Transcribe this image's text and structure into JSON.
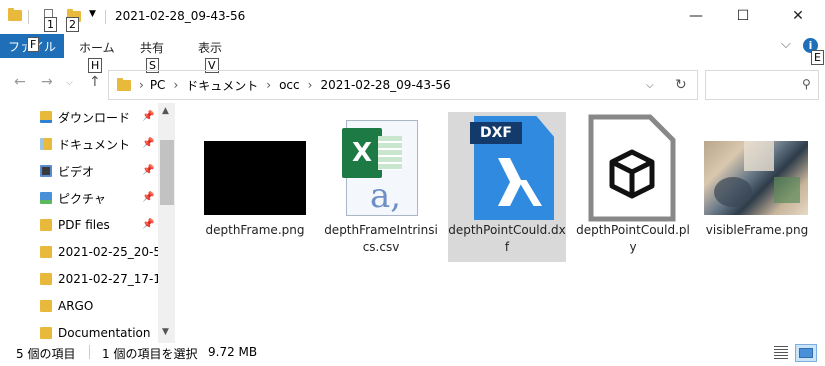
{
  "window": {
    "title": "2021-02-28_09-43-56",
    "minimize": "—",
    "maximize": "☐",
    "close": "✕"
  },
  "quick_access": {
    "key_tip_1": "1",
    "key_tip_2": "2"
  },
  "ribbon": {
    "file_tab": "ファイル",
    "file_key_tip": "F",
    "tabs": [
      {
        "label": "ホーム",
        "key_tip": "H"
      },
      {
        "label": "共有",
        "key_tip": "S"
      },
      {
        "label": "表示",
        "key_tip": "V"
      }
    ],
    "help_key_tip": "E"
  },
  "address": {
    "path": [
      "PC",
      "ドキュメント",
      "occ",
      "2021-02-28_09-43-56"
    ],
    "separator": "›"
  },
  "search": {
    "placeholder": ""
  },
  "nav_pane": {
    "items": [
      {
        "label": "ダウンロード",
        "pinned": true,
        "icon": "download-folder-icon"
      },
      {
        "label": "ドキュメント",
        "pinned": true,
        "icon": "documents-folder-icon"
      },
      {
        "label": "ビデオ",
        "pinned": true,
        "icon": "videos-folder-icon"
      },
      {
        "label": "ピクチャ",
        "pinned": true,
        "icon": "pictures-folder-icon"
      },
      {
        "label": "PDF files",
        "pinned": true,
        "icon": "folder-icon"
      },
      {
        "label": "2021-02-25_20-5",
        "pinned": false,
        "icon": "folder-icon"
      },
      {
        "label": "2021-02-27_17-1",
        "pinned": false,
        "icon": "folder-icon"
      },
      {
        "label": "ARGO",
        "pinned": false,
        "icon": "folder-icon"
      },
      {
        "label": "Documentation",
        "pinned": false,
        "icon": "folder-icon"
      }
    ]
  },
  "files": [
    {
      "name": "depthFrame.png",
      "icon": "png-thumbnail-icon",
      "selected": false
    },
    {
      "name": "depthFrameIntrinsics.csv",
      "icon": "excel-csv-icon",
      "selected": false
    },
    {
      "name": "depthPointCould.dxf",
      "icon": "dxf-file-icon",
      "selected": true,
      "badge": "DXF"
    },
    {
      "name": "depthPointCould.ply",
      "icon": "3d-object-icon",
      "selected": false
    },
    {
      "name": "visibleFrame.png",
      "icon": "image-thumbnail-icon",
      "selected": false
    }
  ],
  "status": {
    "item_count": "5 個の項目",
    "selection": "1 個の項目を選択",
    "size": "9.72 MB"
  },
  "colors": {
    "accent": "#1e6fb8",
    "folder": "#e8b93a",
    "selected_bg": "#d9d9d9",
    "dxf_blue": "#2f8ae0"
  }
}
